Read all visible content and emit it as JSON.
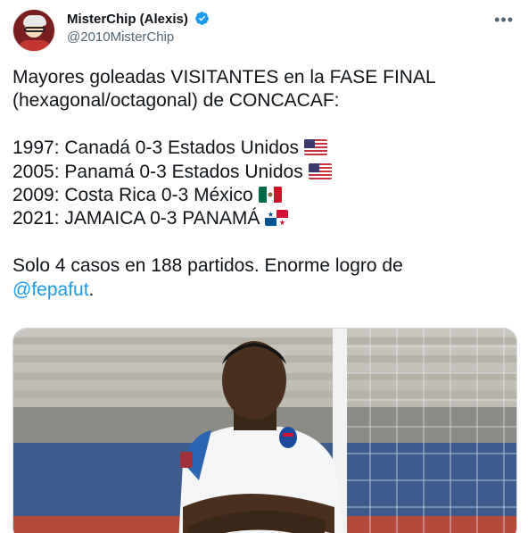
{
  "author": {
    "display_name": "MisterChip (Alexis)",
    "handle": "@2010MisterChip",
    "verified": true
  },
  "more_icon": "more-horizontal-icon",
  "tweet": {
    "line1": "Mayores goleadas VISITANTES en la FASE FINAL",
    "line2": "(hexagonal/octagonal) de CONCACAF:",
    "results": [
      {
        "text": "1997: Canadá 0-3 Estados Unidos",
        "flag": "usa-flag-icon"
      },
      {
        "text": "2005: Panamá 0-3 Estados Unidos",
        "flag": "usa-flag-icon"
      },
      {
        "text": "2009: Costa Rica 0-3 México",
        "flag": "mexico-flag-icon"
      },
      {
        "text": "2021: JAMAICA 0-3 PANAMÁ",
        "flag": "panama-flag-icon"
      }
    ],
    "footer": "Solo 4 casos en 188 partidos. Enorme logro de",
    "mention": "@fepafut",
    "mention_suffix": "."
  },
  "media": {
    "description_icon": "football-player-photo"
  },
  "colors": {
    "link": "#1d9bf0",
    "secondary_text": "#536471",
    "verified": "#1d9bf0"
  }
}
